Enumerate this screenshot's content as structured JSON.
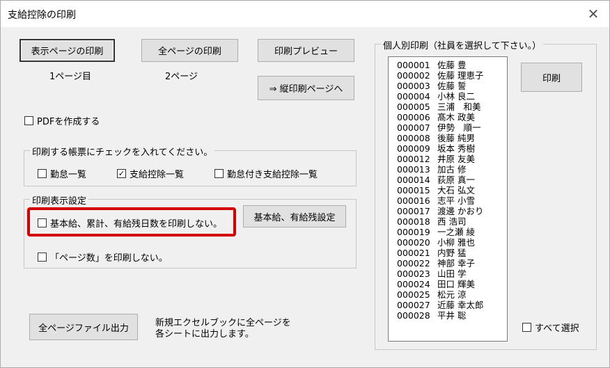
{
  "window": {
    "title": "支給控除の印刷"
  },
  "buttons": {
    "print_page": "表示ページの印刷",
    "print_all": "全ページの印刷",
    "preview": "印刷プレビュー",
    "vertical": "⇒ 縦印刷ページへ",
    "base_setting": "基本給、有給残設定",
    "export_all": "全ページファイル出力",
    "individual_print": "印刷"
  },
  "labels": {
    "page_current": "1ページ目",
    "page_total": "2ページ",
    "export_desc_1": "新規エクセルブックに全ページを",
    "export_desc_2": "各シートに出力します。"
  },
  "checkboxes": {
    "pdf": {
      "label": "PDFを作成する",
      "checked": false
    },
    "attendance_list": {
      "label": "勤怠一覧",
      "checked": false
    },
    "deduction_list": {
      "label": "支給控除一覧",
      "checked": true
    },
    "attendance_deduction_list": {
      "label": "勤怠付き支給控除一覧",
      "checked": false
    },
    "no_base_pay": {
      "label": "基本給、累計、有給残日数を印刷しない。",
      "checked": false
    },
    "no_page_num": {
      "label": "「ページ数」を印刷しない。",
      "checked": false
    },
    "select_all": {
      "label": "すべて選択",
      "checked": false
    }
  },
  "groups": {
    "form_select": "印刷する帳票にチェックを入れてください。",
    "display_setting": "印刷表示設定",
    "individual": "個人別印刷（社員を選択して下さい。）"
  },
  "check_mark": "✓",
  "employees": [
    {
      "code": "000001",
      "name": "佐藤 豊"
    },
    {
      "code": "000002",
      "name": "佐藤 理恵子"
    },
    {
      "code": "000003",
      "name": "佐藤 誓"
    },
    {
      "code": "000004",
      "name": "小林 良二"
    },
    {
      "code": "000005",
      "name": "三浦　和美"
    },
    {
      "code": "000006",
      "name": "髙木 政美"
    },
    {
      "code": "000007",
      "name": "伊勢　順一"
    },
    {
      "code": "000008",
      "name": "後藤 純男"
    },
    {
      "code": "000009",
      "name": "坂本 秀樹"
    },
    {
      "code": "000012",
      "name": "井原 友美"
    },
    {
      "code": "000013",
      "name": "加古 修"
    },
    {
      "code": "000014",
      "name": "荻原 真一"
    },
    {
      "code": "000015",
      "name": "大石 弘文"
    },
    {
      "code": "000016",
      "name": "志平 小雪"
    },
    {
      "code": "000017",
      "name": "渡邊 かおり"
    },
    {
      "code": "000018",
      "name": "西 浩司"
    },
    {
      "code": "000019",
      "name": "一之瀬 綾"
    },
    {
      "code": "000020",
      "name": "小柳 雅也"
    },
    {
      "code": "000021",
      "name": "内野 猛"
    },
    {
      "code": "000022",
      "name": "神部 幸子"
    },
    {
      "code": "000023",
      "name": "山田 学"
    },
    {
      "code": "000024",
      "name": "田口 輝美"
    },
    {
      "code": "000025",
      "name": "松元 涼"
    },
    {
      "code": "000027",
      "name": "近藤 幸太郎"
    },
    {
      "code": "000028",
      "name": "平井 聡"
    }
  ]
}
